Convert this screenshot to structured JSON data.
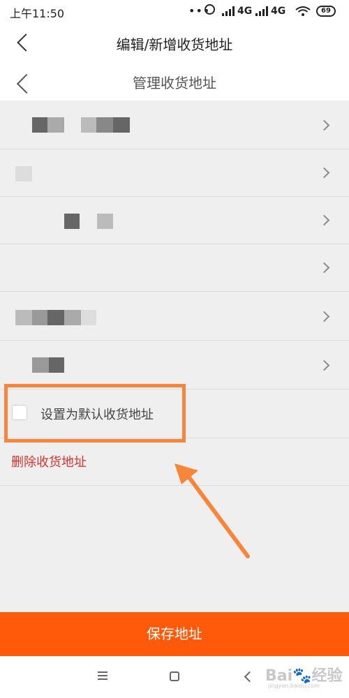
{
  "status_bar": {
    "time": "上午11:50",
    "more": "•••",
    "net1": "4G",
    "net2": "4G",
    "battery": "69"
  },
  "header": {
    "title": "编辑/新增收货地址"
  },
  "subheader": {
    "title": "管理收货地址"
  },
  "form": {
    "default_label": "设置为默认收货地址",
    "delete_label": "删除收货地址"
  },
  "save_button": "保存地址",
  "watermark": {
    "text": "Bai🐾经验",
    "sub": "jingyan.baidu.com"
  },
  "colors": {
    "accent": "#ff5a0a",
    "highlight": "#f7853a",
    "delete": "#d9342b"
  }
}
